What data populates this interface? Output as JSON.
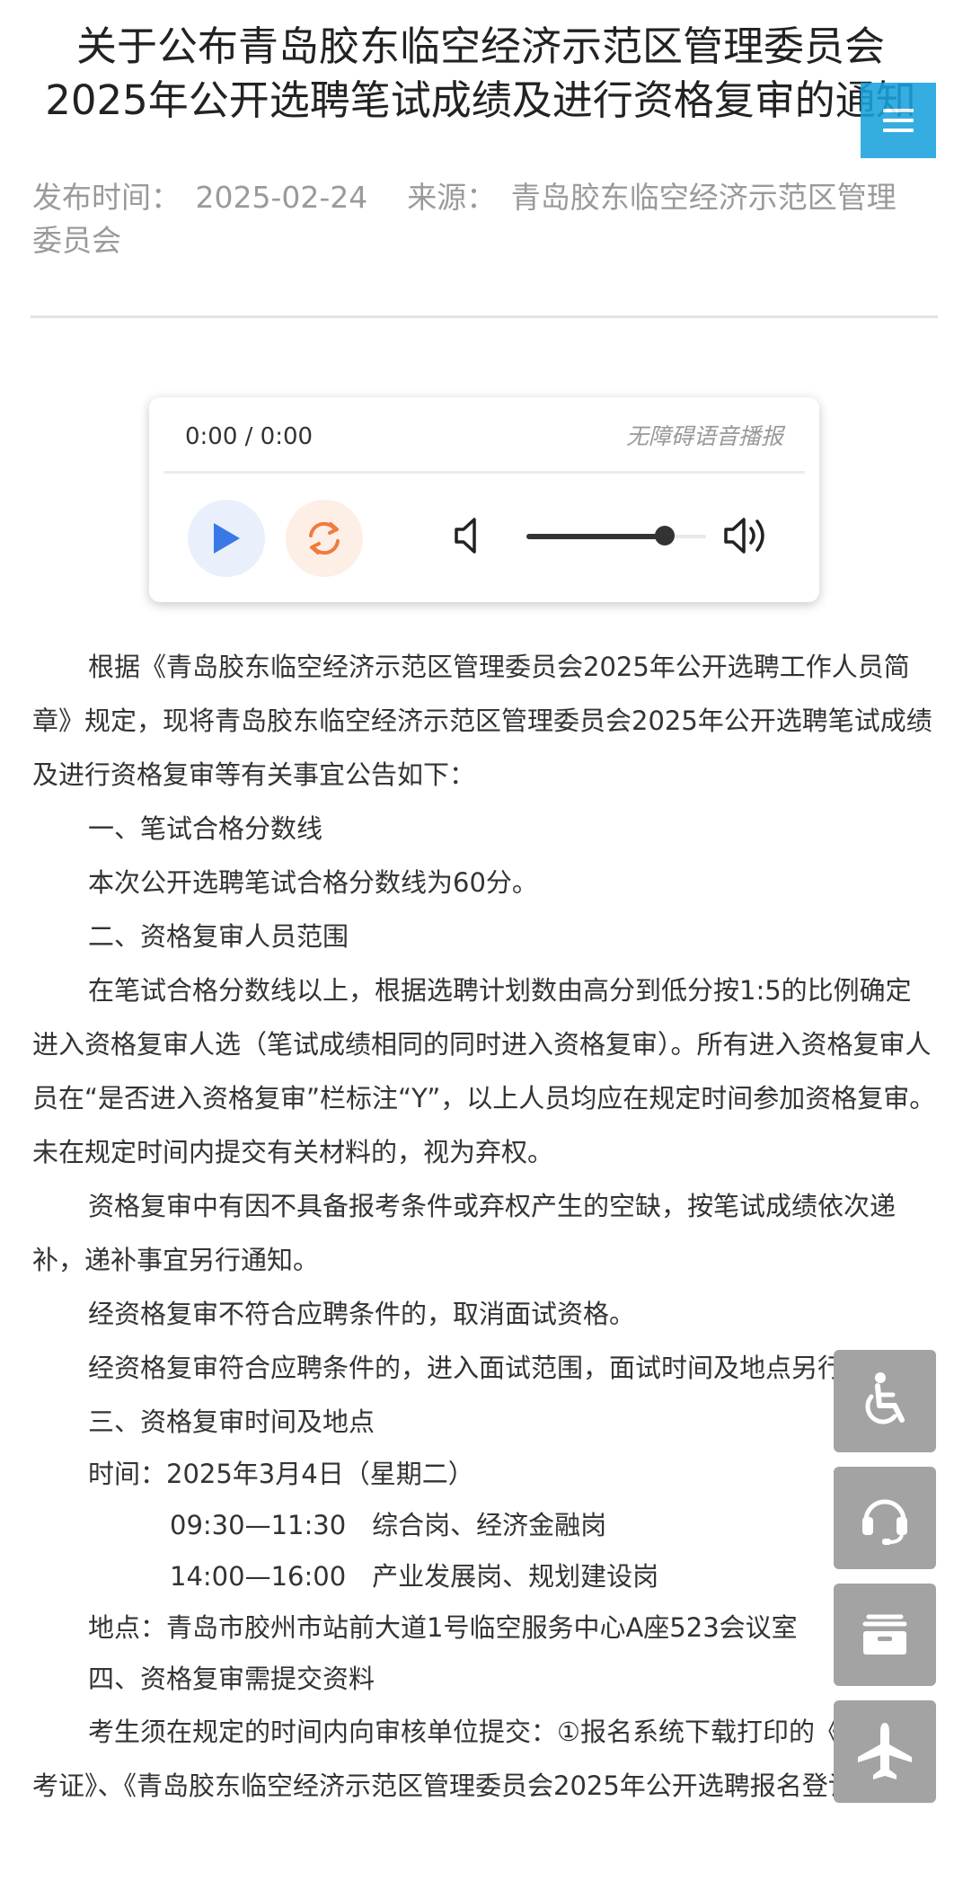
{
  "article": {
    "title_line1": "关于公布青岛胶东临空经济示范区管理委员会",
    "title_line2": "2025年公开选聘笔试成绩及进行资格复审的通知",
    "publish_label": "发布时间：",
    "publish_date": "2025-02-24",
    "source_label": "来源：",
    "source_line1": "青岛胶东临空经济示范区管理",
    "source_line2": "委员会"
  },
  "player": {
    "time_display": "0:00 / 0:00",
    "tts_label": "无障碍语音播报",
    "volume_level": 0.77
  },
  "body": {
    "paragraphs": [
      "根据《青岛胶东临空经济示范区管理委员会2025年公开选聘工作人员简章》规定，现将青岛胶东临空经济示范区管理委员会2025年公开选聘笔试成绩及进行资格复审等有关事宜公告如下：",
      "一、笔试合格分数线",
      "本次公开选聘笔试合格分数线为60分。",
      "二、资格复审人员范围",
      "在笔试合格分数线以上，根据选聘计划数由高分到低分按1:5的比例确定进入资格复审人选（笔试成绩相同的同时进入资格复审）。所有进入资格复审人员在“是否进入资格复审”栏标注“Y”，以上人员均应在规定时间参加资格复审。未在规定时间内提交有关材料的，视为弃权。",
      "资格复审中有因不具备报考条件或弃权产生的空缺，按笔试成绩依次递补，递补事宜另行通知。",
      "经资格复审不符合应聘条件的，取消面试资格。",
      "经资格复审符合应聘条件的，进入面试范围，面试时间及地点另行通知。",
      "三、资格复审时间及地点",
      "时间：2025年3月4日（星期二）",
      "09:30—11:30　综合岗、经济金融岗",
      "14:00—16:00　产业发展岗、规划建设岗",
      "地点：青岛市胶州市站前大道1号临空服务中心A座523会议室",
      "四、资格复审需提交资料",
      "考生须在规定的时间内向审核单位提交：①报名系统下载打印的《笔试准考证》、《青岛胶东临空经济示范区管理委员会2025年公开选聘报名登记表》"
    ]
  },
  "float_tools": {
    "icons": [
      "wheelchair-icon",
      "headset-icon",
      "archive-box-icon",
      "airplane-icon"
    ]
  },
  "colors": {
    "menu_button": "#1aa2dc",
    "float_button": "#a3a3a3",
    "play_icon": "#3a78e6",
    "replay_icon": "#f07b3f"
  }
}
